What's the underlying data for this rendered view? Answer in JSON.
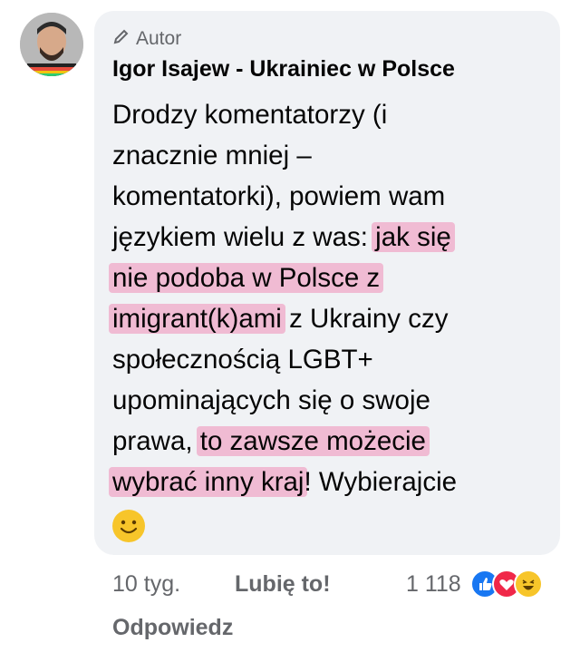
{
  "post": {
    "author_badge": "Autor",
    "author_name": "Igor Isajew - Ukrainiec w Polsce",
    "lines": [
      "Drodzy komentatorzy (i",
      "znacznie mniej –",
      "komentatorki), powiem wam",
      "językiem wielu z was:",
      "jak się",
      "nie podoba w Polsce z",
      "imigrant(k)ami",
      "z Ukrainy czy",
      "społecznością LGBT+",
      "upominających się o swoje",
      "prawa,",
      "to zawsze możecie",
      "wybrać inny kraj",
      "! Wybierajcie"
    ],
    "emoji": "smiling-face-icon"
  },
  "footer": {
    "time": "10 tyg.",
    "like": "Lubię to!",
    "reaction_count": "1 118",
    "reply": "Odpowiedz"
  },
  "reactions": [
    "like-reaction-icon",
    "love-reaction-icon",
    "haha-reaction-icon"
  ],
  "colors": {
    "highlight": "#f07aaa",
    "bubble": "#f0f2f5",
    "meta": "#65676b"
  }
}
